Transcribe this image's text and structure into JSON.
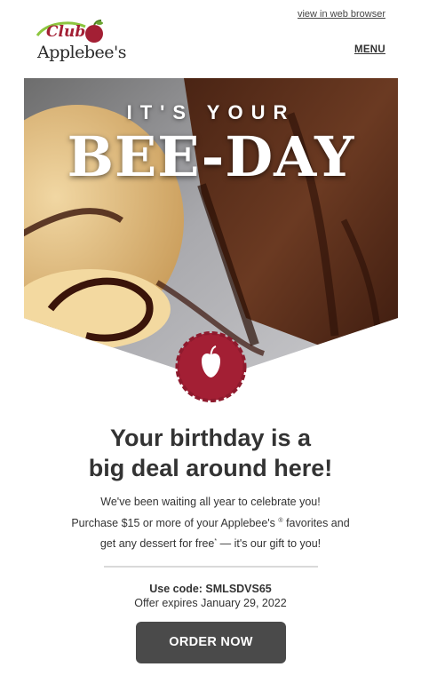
{
  "header": {
    "web_link": "view in web browser",
    "menu": "MENU",
    "logo": {
      "club": "Club",
      "brand": "Applebee's"
    }
  },
  "hero": {
    "small_text": "IT'S YOUR",
    "big_text": "BEE-DAY",
    "icons": [
      "ice-cream-scoop",
      "brownie",
      "apple-badge-icon"
    ]
  },
  "main": {
    "headline_line1": "Your birthday is a",
    "headline_line2": "big deal around here!",
    "body_line1": "We've been waiting all year to celebrate you!",
    "body_line2_a": "Purchase $15 or more of your Applebee's",
    "body_line2_reg": "®",
    "body_line2_b": " favorites and",
    "body_line3_a": "get any dessert for free",
    "body_line3_sup": "*",
    "body_line3_b": " — it's our gift to you!",
    "code_text": "Use code: SMLSDVS65",
    "expires_text": "Offer expires January 29, 2022",
    "cta": "ORDER NOW"
  },
  "colors": {
    "brand_red": "#a31f34",
    "button_bg": "#4a4a4a",
    "divider": "#d9d9d9",
    "text": "#333333"
  }
}
